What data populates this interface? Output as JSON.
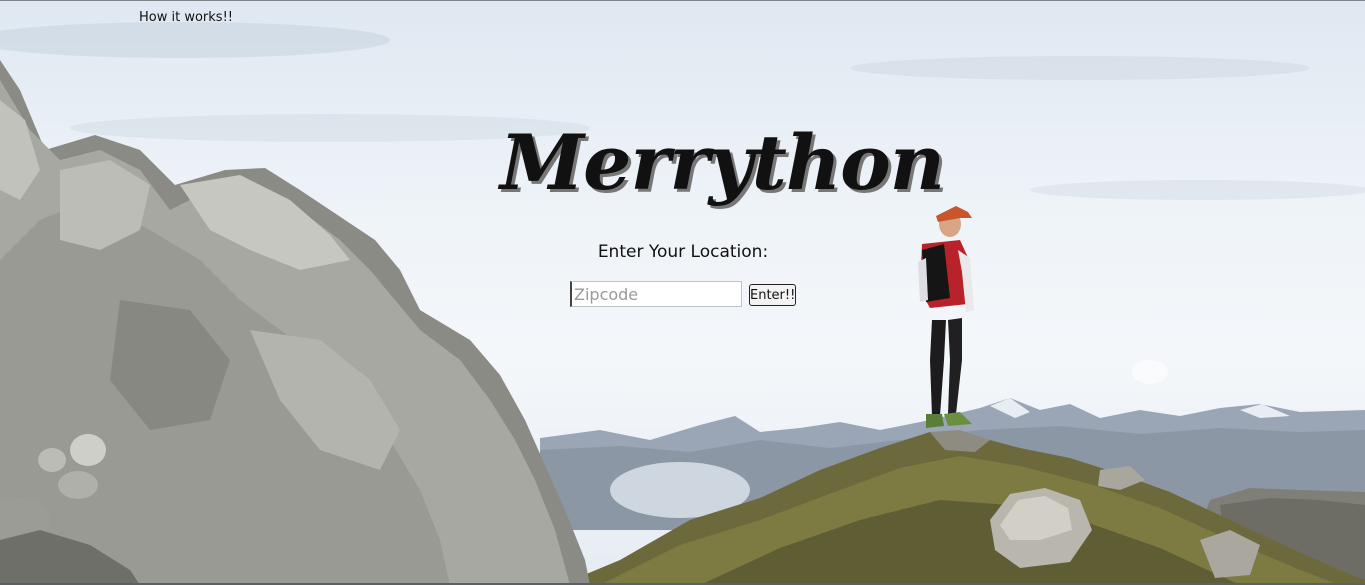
{
  "nav": {
    "how_it_works": "How it works!!"
  },
  "hero": {
    "brand": "Merrython",
    "prompt": "Enter Your Location:"
  },
  "search": {
    "placeholder": "Zipcode",
    "value": "",
    "button_label": "Enter!!"
  },
  "icons": {
    "background": "mountain-summit-runner-photo"
  },
  "colors": {
    "text": "#111111",
    "sky": "#eef3f8"
  }
}
